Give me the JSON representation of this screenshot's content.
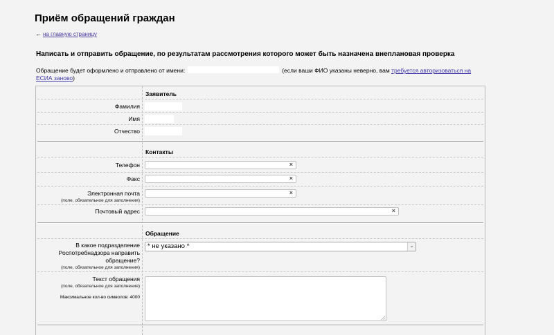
{
  "page": {
    "title": "Приём обращений граждан",
    "back_link": "на главную страницу",
    "back_arrow": "←",
    "heading": "Написать и отправить обращение, по результатам рассмотрения которого может быть назначена внеплановая проверка",
    "sender_prefix": "Обращение будет оформлено и отправлено от имени:",
    "sender_suffix": "(если ваши ФИО указаны неверно, вам",
    "sender_link": "требуется авторизоваться на ЕСИА заново",
    "sender_close": ")"
  },
  "form": {
    "applicant": {
      "title": "Заявитель",
      "last_name_label": "Фамилия",
      "first_name_label": "Имя",
      "patronymic_label": "Отчество"
    },
    "contacts": {
      "title": "Контакты",
      "phone_label": "Телефон",
      "fax_label": "Факс",
      "email_label": "Электронная почта",
      "email_note": "(поле, обязательное для заполнения)",
      "postal_label": "Почтовый адрес"
    },
    "appeal": {
      "title": "Обращение",
      "department_label": "В какое подразделение Роспотребнадзора направить обращение?",
      "department_note": "(поле, обязательное для заполнения)",
      "department_value": "* не указано *",
      "text_label": "Текст обращения",
      "text_note": "(поле, обязательное для заполнения)",
      "max_chars": "Максимальное кол-во символов: 4000"
    },
    "clear_glyph": "×",
    "chevron_glyph": "⌄"
  },
  "colors": {
    "background": "#f3f3f3",
    "link": "#3f37a8",
    "field_border": "#bfbfbf"
  }
}
